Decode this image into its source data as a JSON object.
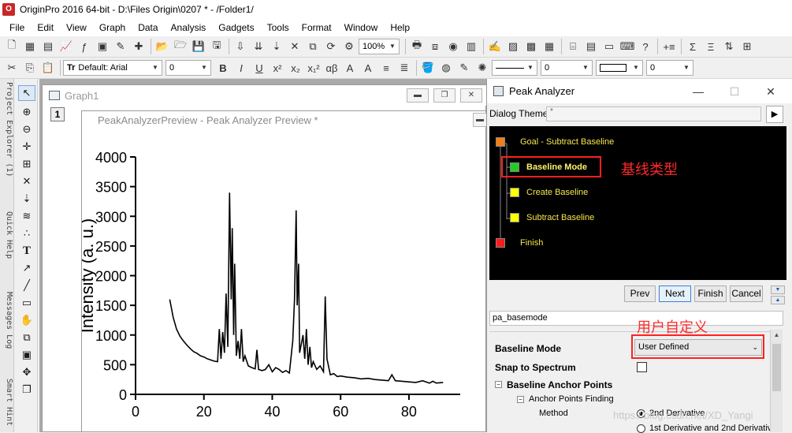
{
  "window": {
    "title": "OriginPro 2016 64-bit - D:\\Files Origin\\0207 * - /Folder1/"
  },
  "menu": [
    "File",
    "Edit",
    "View",
    "Graph",
    "Data",
    "Analysis",
    "Gadgets",
    "Tools",
    "Format",
    "Window",
    "Help"
  ],
  "toolbar": {
    "zoom": "100%",
    "font_combo": "Default: Arial",
    "size_combo": "0",
    "size_combo2": "0",
    "size_combo3": "0",
    "style_buttons": [
      "B",
      "I",
      "U",
      "x²",
      "x₂",
      "x₁²",
      "αβ",
      "A",
      "A"
    ]
  },
  "side_tabs": [
    "Project Explorer (1)",
    "Quick Help",
    "Messages Log",
    "Smart Hint"
  ],
  "graph_window": {
    "title": "Graph1",
    "layer": "1"
  },
  "preview_window": {
    "title": "PeakAnalyzerPreview - Peak Analyzer Preview *"
  },
  "chart_data": {
    "type": "line",
    "ylabel": "Intensity (a. u.)",
    "xlabel": "",
    "xlim": [
      0,
      95
    ],
    "ylim": [
      0,
      4000
    ],
    "x_ticks": [
      "0",
      "20",
      "40",
      "60",
      "80"
    ],
    "y_ticks": [
      "0",
      "500",
      "1000",
      "1500",
      "2000",
      "2500",
      "3000",
      "3500",
      "4000"
    ],
    "series": [
      {
        "color": "#000000",
        "x": [
          10,
          11,
          12,
          13,
          14,
          15,
          16,
          17,
          18,
          19,
          20,
          21,
          22,
          23,
          24,
          24.5,
          25,
          25.5,
          26,
          26.5,
          27,
          27.5,
          28,
          28.3,
          28.7,
          29,
          29.5,
          30,
          30.5,
          31,
          31.5,
          32,
          33,
          34,
          35,
          35.5,
          36,
          37,
          38,
          39,
          40,
          41,
          42,
          43,
          44,
          45,
          46,
          46.5,
          47,
          47.3,
          47.7,
          48,
          49,
          49.5,
          50,
          50.5,
          51,
          51.5,
          52,
          53,
          54,
          55,
          55.5,
          56,
          57,
          58,
          59,
          60,
          62,
          64,
          66,
          68,
          70,
          72,
          74,
          75,
          76,
          78,
          80,
          82,
          84,
          86,
          87,
          88,
          90
        ],
        "values": [
          1600,
          1300,
          1100,
          980,
          900,
          830,
          770,
          720,
          690,
          650,
          630,
          600,
          580,
          560,
          550,
          1100,
          600,
          1050,
          700,
          1700,
          800,
          3400,
          1600,
          2800,
          1000,
          2200,
          650,
          900,
          600,
          1100,
          550,
          650,
          480,
          450,
          430,
          750,
          420,
          400,
          420,
          500,
          380,
          450,
          420,
          370,
          400,
          360,
          900,
          1600,
          3100,
          1500,
          2200,
          700,
          1000,
          600,
          1100,
          500,
          800,
          450,
          550,
          420,
          480,
          380,
          1650,
          600,
          330,
          350,
          300,
          310,
          290,
          280,
          260,
          270,
          250,
          240,
          230,
          330,
          230,
          220,
          210,
          200,
          230,
          190,
          220,
          190,
          200
        ]
      }
    ]
  },
  "dialog": {
    "title": "Peak Analyzer",
    "theme_label": "Dialog Theme",
    "theme_value": "*",
    "steps": [
      "Goal - Subtract Baseline",
      "Baseline Mode",
      "Create Baseline",
      "Subtract Baseline",
      "Finish"
    ],
    "step_colors": [
      "#f07f16",
      "#22cc22",
      "#ffff00",
      "#ffff00",
      "#ff1a1a"
    ],
    "nav": {
      "prev": "Prev",
      "next": "Next",
      "finish": "Finish",
      "cancel": "Cancel"
    },
    "page_name": "pa_basemode",
    "props": {
      "baseline_mode_label": "Baseline Mode",
      "baseline_mode_value": "User Defined",
      "snap_label": "Snap to Spectrum",
      "anchor_group": "Baseline Anchor Points",
      "finding_group": "Anchor Points Finding",
      "method_label": "Method",
      "method_opt1": "2nd Derivative",
      "method_opt2": "1st Derivative and 2nd Derivativ"
    }
  },
  "annotations": {
    "baseline_type": "基线类型",
    "user_defined": "用户自定义"
  },
  "watermark": "https://blog.csdn.net/XD_Yangi"
}
